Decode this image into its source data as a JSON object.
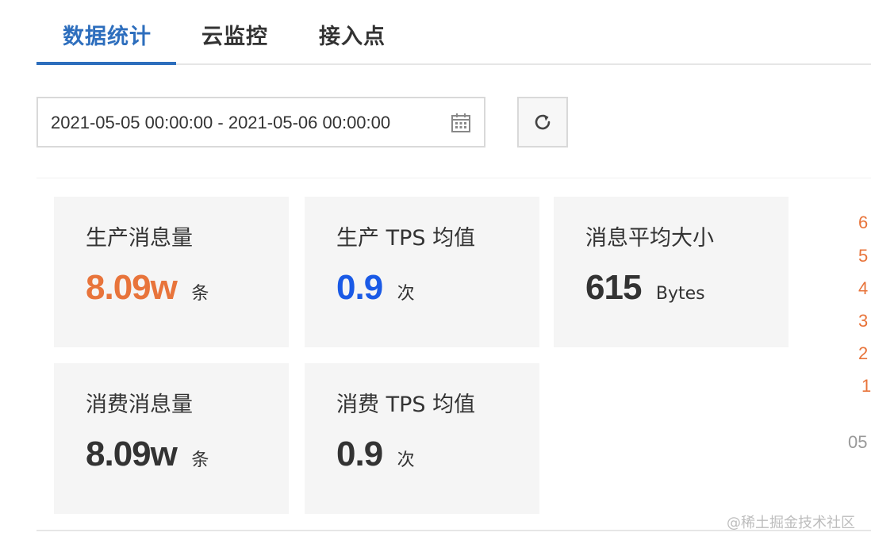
{
  "tabs": [
    {
      "label": "数据统计",
      "active": true
    },
    {
      "label": "云监控",
      "active": false
    },
    {
      "label": "接入点",
      "active": false
    }
  ],
  "date_range": {
    "value": "2021-05-05 00:00:00 - 2021-05-06 00:00:00",
    "icon": "calendar-icon"
  },
  "refresh": {
    "icon": "refresh-icon"
  },
  "stats": {
    "produced_messages": {
      "label": "生产消息量",
      "value": "8.09w",
      "unit": "条",
      "color": "#e8743b"
    },
    "produce_tps": {
      "label": "生产 TPS 均值",
      "value": "0.9",
      "unit": "次",
      "color": "#1a5ae6"
    },
    "avg_message_size": {
      "label": "消息平均大小",
      "value": "615",
      "unit": "Bytes",
      "color": "#333333"
    },
    "consumed_messages": {
      "label": "消费消息量",
      "value": "8.09w",
      "unit": "条",
      "color": "#333333"
    },
    "consume_tps": {
      "label": "消费 TPS 均值",
      "value": "0.9",
      "unit": "次",
      "color": "#333333"
    }
  },
  "chart_axis": {
    "y_ticks": [
      "6",
      "5",
      "4",
      "3",
      "2",
      "1"
    ],
    "x_tick": "05"
  },
  "watermark": "@稀土掘金技术社区"
}
